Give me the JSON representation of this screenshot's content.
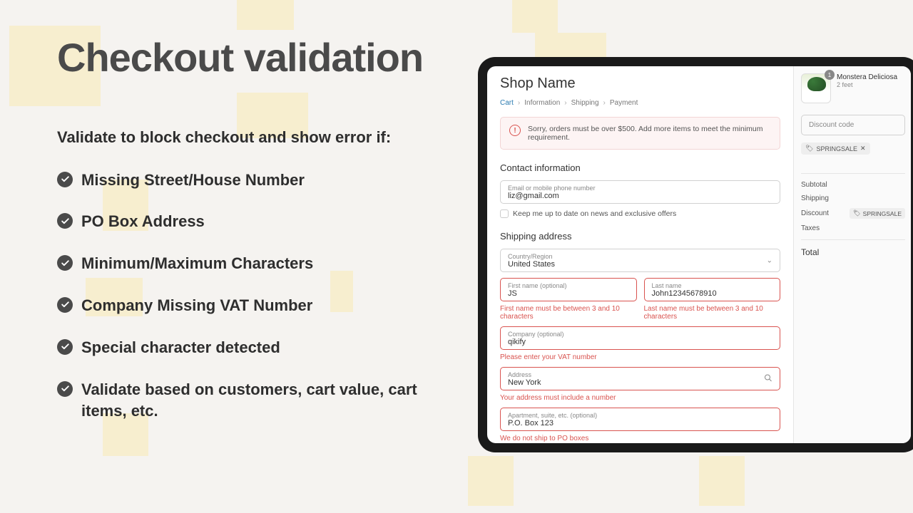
{
  "heading": "Checkout validation",
  "subtitle": "Validate to block checkout and show error if:",
  "items": [
    "Missing Street/House Number",
    "PO Box Address",
    "Minimum/Maximum Characters",
    "Company Missing VAT Number",
    "Special character detected",
    "Validate based on customers, cart value, cart items, etc."
  ],
  "checkout": {
    "shopName": "Shop Name",
    "breadcrumbs": {
      "cart": "Cart",
      "info": "Information",
      "ship": "Shipping",
      "pay": "Payment"
    },
    "alert": "Sorry, orders must be over $500. Add more items to meet the minimum requirement.",
    "contact": {
      "heading": "Contact information",
      "emailLabel": "Email or mobile phone number",
      "emailValue": "liz@gmail.com",
      "consent": "Keep me up to date on news and exclusive offers"
    },
    "shipping": {
      "heading": "Shipping address",
      "countryLabel": "Country/Region",
      "countryValue": "United States",
      "firstNameLabel": "First name (optional)",
      "firstNameValue": "JS",
      "firstNameError": "First name must be between 3 and 10 characters",
      "lastNameLabel": "Last name",
      "lastNameValue": "John12345678910",
      "lastNameError": "Last name must be between 3 and 10 characters",
      "companyLabel": "Company (optional)",
      "companyValue": "qikify",
      "companyError": "Please enter your VAT number",
      "addressLabel": "Address",
      "addressValue": "New York",
      "addressError": "Your address must include a number",
      "aptLabel": "Apartment, suite, etc. (optional)",
      "aptValue": "P.O. Box 123",
      "aptError": "We do not ship to PO boxes"
    },
    "summary": {
      "productName": "Monstera Deliciosa",
      "productVariant": "2 feet",
      "discountPlaceholder": "Discount code",
      "discountTag": "SPRINGSALE",
      "subtotal": "Subtotal",
      "shipping": "Shipping",
      "discount": "Discount",
      "taxes": "Taxes",
      "total": "Total"
    }
  }
}
